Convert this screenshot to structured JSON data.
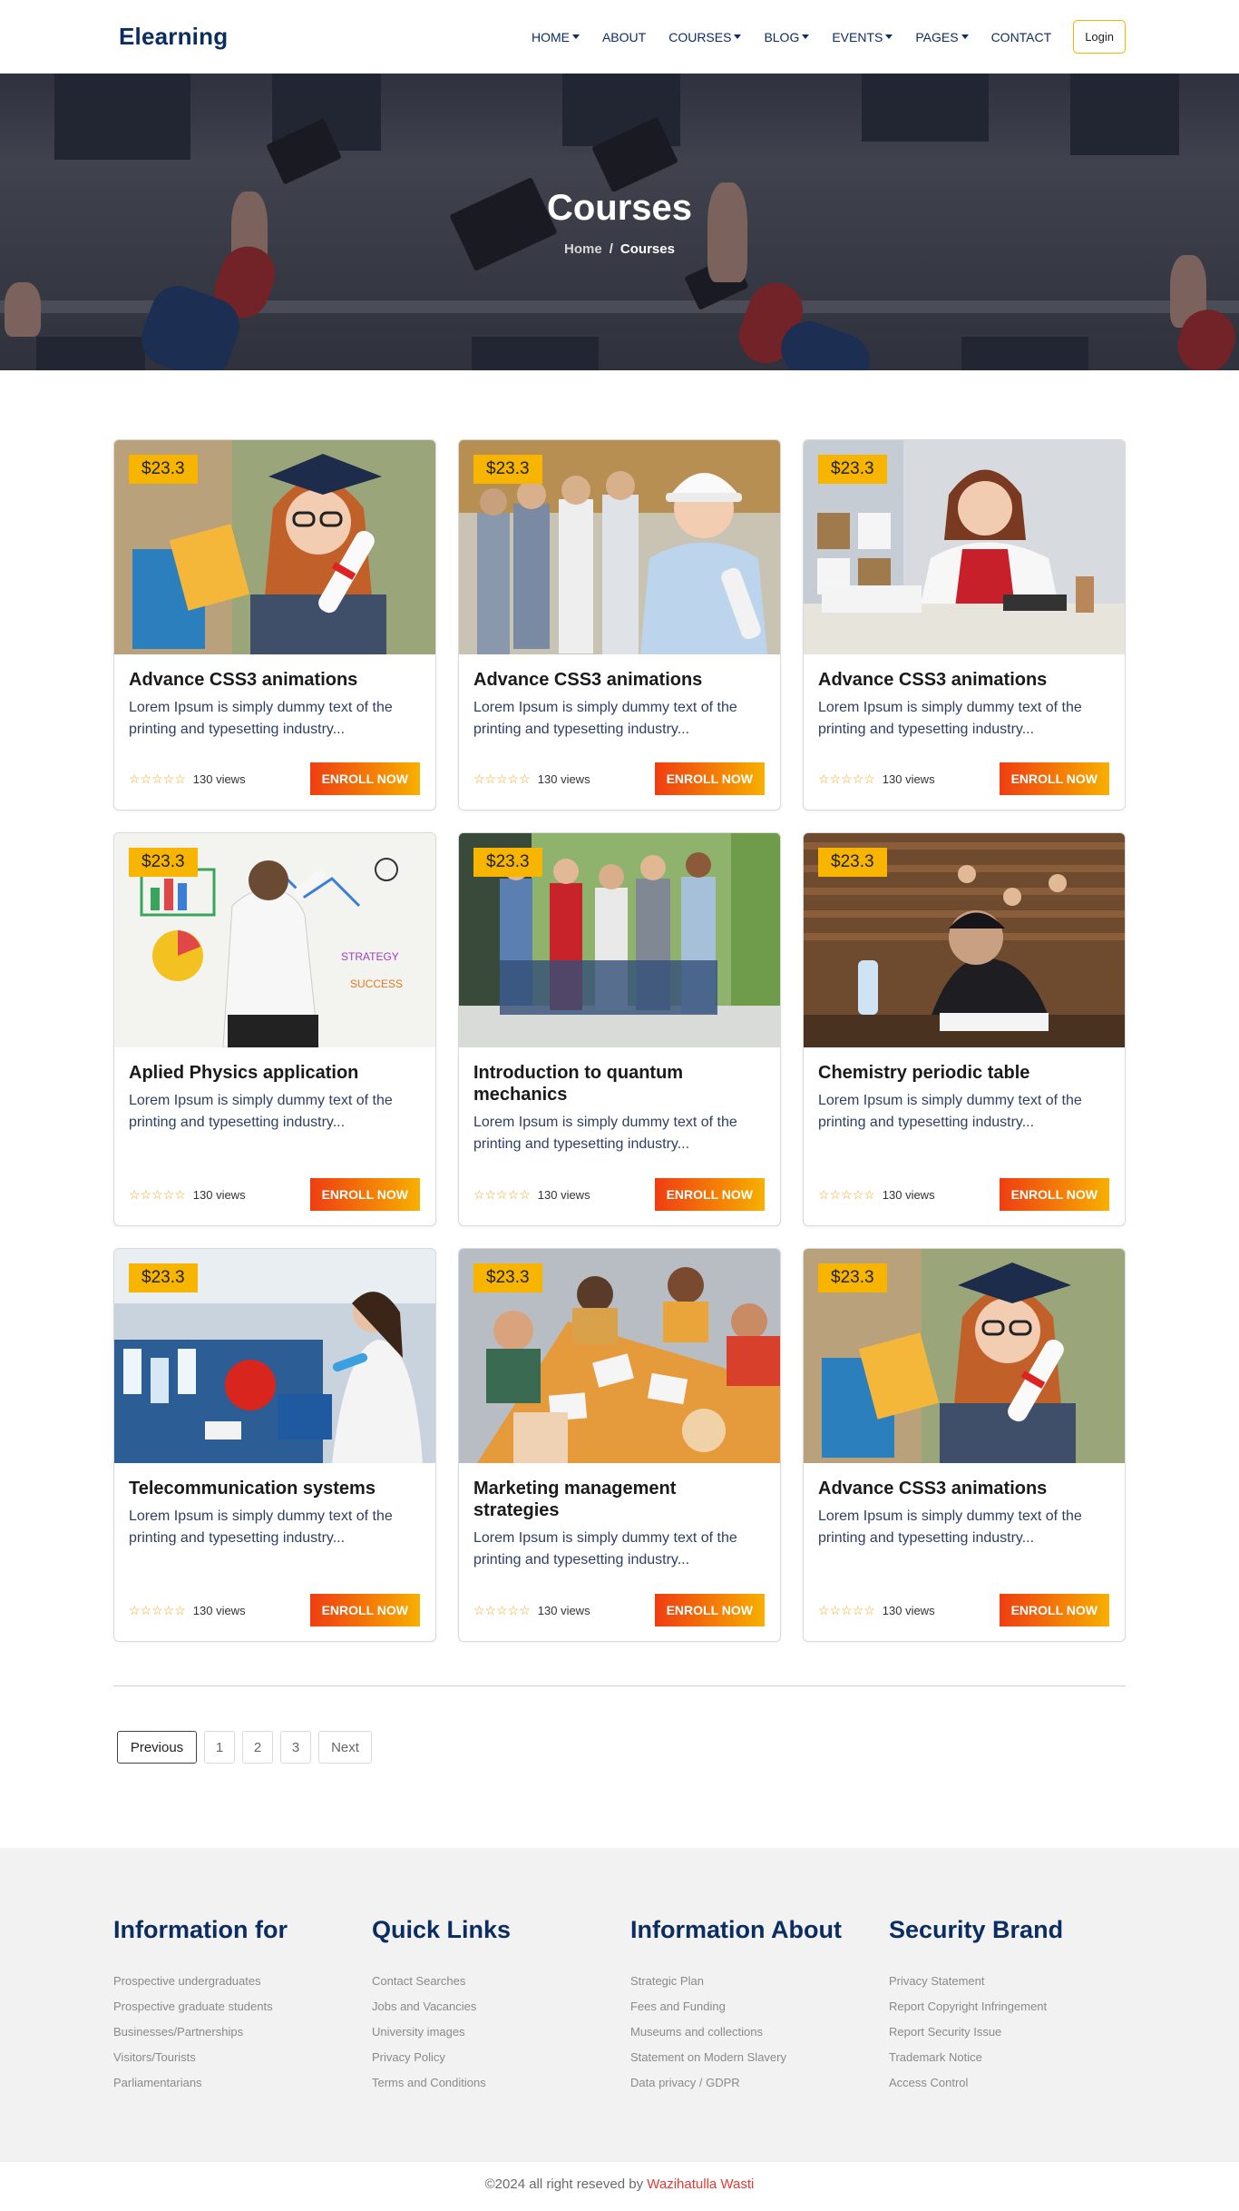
{
  "navbar": {
    "brand": "Elearning",
    "items": [
      {
        "label": "HOME",
        "dropdown": true
      },
      {
        "label": "ABOUT",
        "dropdown": false
      },
      {
        "label": "COURSES",
        "dropdown": true
      },
      {
        "label": "BLOG",
        "dropdown": true
      },
      {
        "label": "EVENTS",
        "dropdown": true
      },
      {
        "label": "PAGES",
        "dropdown": true
      },
      {
        "label": "CONTACT",
        "dropdown": false
      }
    ],
    "login": "Login"
  },
  "hero": {
    "title": "Courses",
    "breadcrumb_home": "Home",
    "breadcrumb_sep": "/",
    "breadcrumb_current": "Courses"
  },
  "courses": [
    {
      "price": "$23.3",
      "title": "Advance CSS3 animations",
      "text": "Lorem Ipsum is simply dummy text of the printing and typesetting industry...",
      "views": "130 views",
      "button": "ENROLL NOW",
      "image": "graduate-student-photo"
    },
    {
      "price": "$23.3",
      "title": "Advance CSS3 animations",
      "text": "Lorem Ipsum is simply dummy text of the printing and typesetting industry...",
      "views": "130 views",
      "button": "ENROLL NOW",
      "image": "engineer-hardhat-photo"
    },
    {
      "price": "$23.3",
      "title": "Advance CSS3 animations",
      "text": "Lorem Ipsum is simply dummy text of the printing and typesetting industry...",
      "views": "130 views",
      "button": "ENROLL NOW",
      "image": "office-worker-photo"
    },
    {
      "price": "$23.3",
      "title": "Aplied Physics application",
      "text": "Lorem Ipsum is simply dummy text of the printing and typesetting industry...",
      "views": "130 views",
      "button": "ENROLL NOW",
      "image": "whiteboard-drawing-photo"
    },
    {
      "price": "$23.3",
      "title": "Introduction to quantum mechanics",
      "text": "Lorem Ipsum is simply dummy text of the printing and typesetting industry...",
      "views": "130 views",
      "button": "ENROLL NOW",
      "image": "students-walking-photo"
    },
    {
      "price": "$23.3",
      "title": "Chemistry periodic table",
      "text": "Lorem Ipsum is simply dummy text of the printing and typesetting industry...",
      "views": "130 views",
      "button": "ENROLL NOW",
      "image": "lecture-hall-photo"
    },
    {
      "price": "$23.3",
      "title": "Telecommunication systems",
      "text": "Lorem Ipsum is simply dummy text of the printing and typesetting industry...",
      "views": "130 views",
      "button": "ENROLL NOW",
      "image": "laboratory-photo"
    },
    {
      "price": "$23.3",
      "title": "Marketing management strategies",
      "text": "Lorem Ipsum is simply dummy text of the printing and typesetting industry...",
      "views": "130 views",
      "button": "ENROLL NOW",
      "image": "group-study-photo"
    },
    {
      "price": "$23.3",
      "title": "Advance CSS3 animations",
      "text": "Lorem Ipsum is simply dummy text of the printing and typesetting industry...",
      "views": "130 views",
      "button": "ENROLL NOW",
      "image": "graduate-student-photo"
    }
  ],
  "rating_stars": "☆☆☆☆☆",
  "pagination": {
    "previous": "Previous",
    "pages": [
      "1",
      "2",
      "3"
    ],
    "next": "Next"
  },
  "footer": {
    "columns": [
      {
        "title": "Information for",
        "links": [
          "Prospective undergraduates",
          "Prospective graduate students",
          "Businesses/Partnerships",
          "Visitors/Tourists",
          "Parliamentarians"
        ]
      },
      {
        "title": "Quick Links",
        "links": [
          "Contact Searches",
          "Jobs and Vacancies",
          "University images",
          "Privacy Policy",
          "Terms and Conditions"
        ]
      },
      {
        "title": "Information About",
        "links": [
          "Strategic Plan",
          "Fees and Funding",
          "Museums and collections",
          "Statement on Modern Slavery",
          "Data privacy / GDPR"
        ]
      },
      {
        "title": "Security Brand",
        "links": [
          "Privacy Statement",
          "Report Copyright Infringement",
          "Report Security Issue",
          "Trademark Notice",
          "Access Control"
        ]
      }
    ],
    "copyright": "©2024 all right reseved by",
    "author": "Wazihatulla Wasti"
  },
  "colors": {
    "brand": "#0c2d62",
    "price_badge": "#f7b500",
    "button_gradient_start": "#ef3d12",
    "button_gradient_end": "#f7b000",
    "author_link": "#e53935"
  }
}
